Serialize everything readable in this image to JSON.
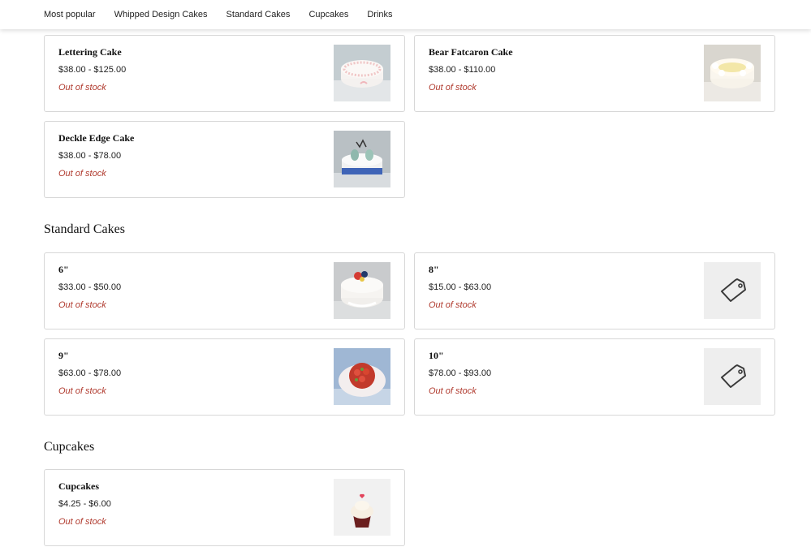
{
  "nav": {
    "items": [
      {
        "label": "Most popular"
      },
      {
        "label": "Whipped Design Cakes"
      },
      {
        "label": "Standard Cakes"
      },
      {
        "label": "Cupcakes"
      },
      {
        "label": "Drinks"
      }
    ]
  },
  "whipped": {
    "products": [
      {
        "name": "Lettering Cake",
        "price": "$38.00 - $125.00",
        "status": "Out of stock",
        "image": "lettering-cake-photo"
      },
      {
        "name": "Bear Fatcaron Cake",
        "price": "$38.00 - $110.00",
        "status": "Out of stock",
        "image": "bear-fatcaron-cake-photo"
      },
      {
        "name": "Deckle Edge Cake",
        "price": "$38.00 - $78.00",
        "status": "Out of stock",
        "image": "deckle-edge-cake-photo"
      }
    ]
  },
  "standard": {
    "title": "Standard Cakes",
    "products": [
      {
        "name": "6\"",
        "price": "$33.00 - $50.00",
        "status": "Out of stock",
        "image": "six-inch-cake-photo"
      },
      {
        "name": "8\"",
        "price": "$15.00 - $63.00",
        "status": "Out of stock",
        "image": "price-tag-icon"
      },
      {
        "name": "9\"",
        "price": "$63.00 - $78.00",
        "status": "Out of stock",
        "image": "nine-inch-strawberry-cake-photo"
      },
      {
        "name": "10\"",
        "price": "$78.00 - $93.00",
        "status": "Out of stock",
        "image": "price-tag-icon"
      }
    ]
  },
  "cupcakes": {
    "title": "Cupcakes",
    "products": [
      {
        "name": "Cupcakes",
        "price": "$4.25 - $6.00",
        "status": "Out of stock",
        "image": "cupcake-photo"
      }
    ]
  },
  "colors": {
    "out_of_stock": "#b03a2e",
    "card_border": "#d7d7d7",
    "placeholder_bg": "#eeeeee"
  }
}
